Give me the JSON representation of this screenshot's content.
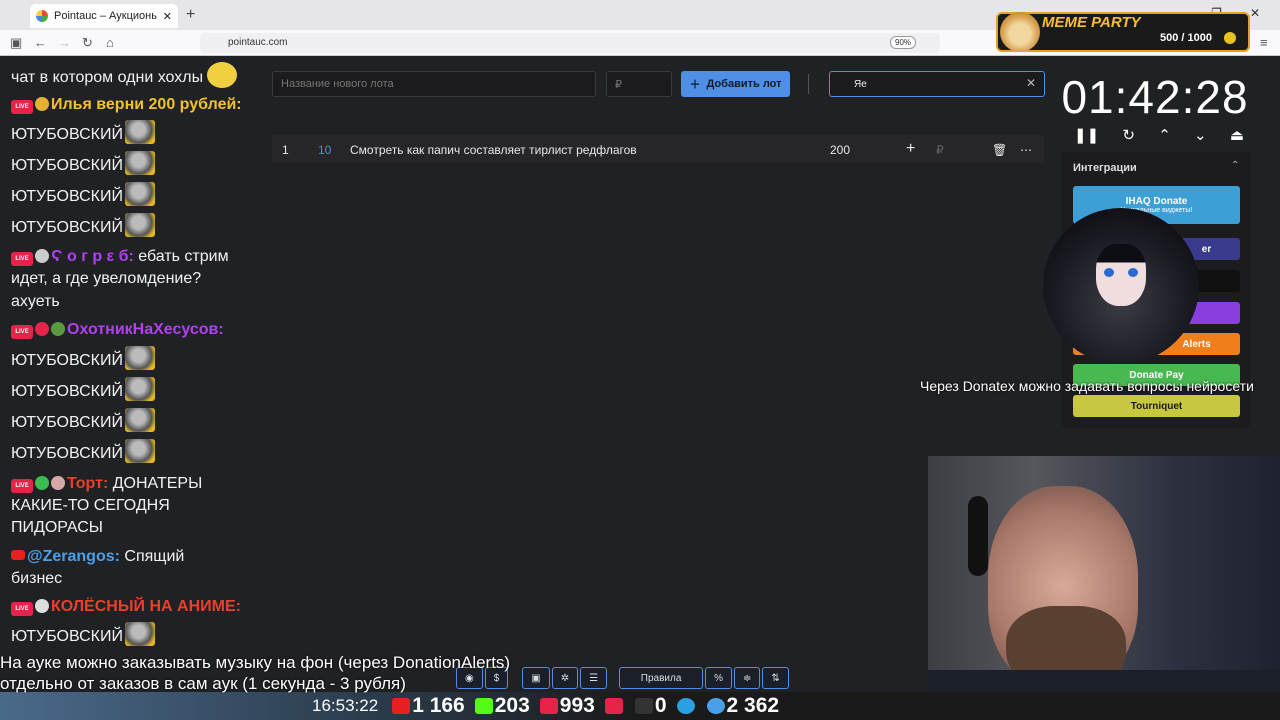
{
  "browser": {
    "tab_title": "Pointauc – Аукционы, лотереи",
    "new_tab": "+",
    "url": "pointauc.com",
    "zoom": "90%"
  },
  "auction": {
    "lot_name_placeholder": "Название нового лота",
    "price_placeholder": "₽",
    "add_lot_label": "Добавить лот",
    "search_value": "Яе",
    "lots": [
      {
        "index": "1",
        "percent": "10",
        "name": "Смотреть как папич составляет тирлист редфлагов",
        "amount": "200",
        "currency": "₽"
      }
    ]
  },
  "timer": {
    "value": "01:42:28"
  },
  "integrations": {
    "title": "Интеграции",
    "ihaq_label": "IHAQ Donate",
    "ihaq_sub": "Уникальные виджеты!",
    "item2": "er",
    "donationalerts": "Alerts",
    "donatepay": "Donate Pay",
    "tourniquet": "Tourniquet"
  },
  "overlay": {
    "donatex_note": "Через Donatex можно задавать вопросы нейросети",
    "meme_party": "MEME PARTY",
    "meme_score": "500 / 1000",
    "sub_line1": "На ауке можно заказывать музыку на фон (через DonationAlerts)",
    "sub_line2": "отдельно от заказов в сам аук (1 секунда - 3 рубля)",
    "rules": "Правила",
    "percent": "%",
    "clock": "16:53:22",
    "youtube_count": "1 166",
    "kick_count": "203",
    "vk_count": "993",
    "r_count": "0",
    "users_count": "2 362"
  },
  "chat": {
    "l1": "чат в котором одни хохлы",
    "n1": "Илья верни 200 рублей:",
    "yt": "ЮТУБОВСКИЙ",
    "n2": "Ϛ о г р ε б:",
    "m2a": "ебать стрим",
    "m2b": "идет, а где увеломдение?",
    "m2c": "ахуеть",
    "n3": "ОхотникНаХесусов:",
    "n4": "Торт:",
    "m4a": "ДОНАТЕРЫ",
    "m4b": "КАКИЕ-ТО СЕГОДНЯ",
    "m4c": "ПИДОРАСЫ",
    "n5": "@Zerangos:",
    "m5a": "Спящий",
    "m5b": "бизнес",
    "n6": "КОЛЁСНЫЙ НА АНИМЕ:",
    "live": "LIVE"
  },
  "colors": {
    "accent": "#4f8fe6",
    "nick_yellow": "#f2c12e",
    "nick_purple": "#b040f0",
    "nick_red": "#e8402a",
    "nick_blue": "#4aa0e8"
  }
}
